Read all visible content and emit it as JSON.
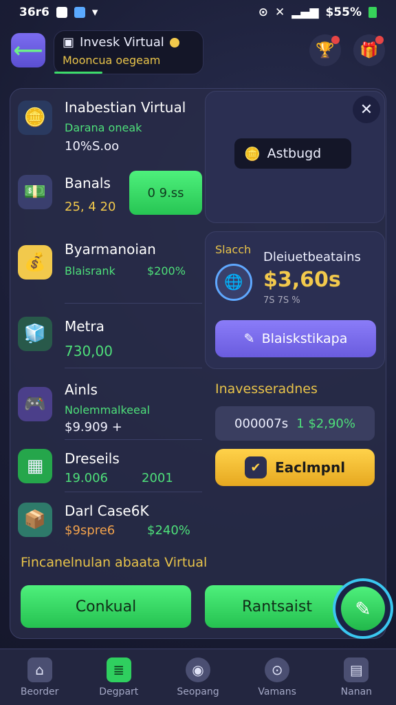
{
  "status_bar": {
    "time": "36r6",
    "right": "$55%"
  },
  "header": {
    "title": "Invesk Virtual",
    "subtitle": "Mooncua oegeam"
  },
  "list": [
    {
      "title": "Inabestian Virtual",
      "sub": "Darana oneak",
      "value": "10%S.oo",
      "icon": "coin-stack-icon",
      "color": "#f2c94c"
    },
    {
      "title": "Banals",
      "sub": "",
      "value": "25, 4 20",
      "icon": "money-box-icon",
      "color": "#cfd3ff",
      "button": "0 9.ss"
    },
    {
      "title": "Byarmanoian",
      "sub": "Blaisrank",
      "sub_value": "$200%",
      "icon": "cash-box-icon",
      "color": "#f2c94c"
    },
    {
      "title": "Metra",
      "sub": "",
      "value": "730,00",
      "icon": "cubes-icon",
      "color": "#4ee07a"
    },
    {
      "title": "Ainls",
      "sub": "Nolemmalkeeal",
      "value": "$9.909 +",
      "icon": "gamepad-icon",
      "color": "#8a7cf8"
    },
    {
      "title": "Dreseils",
      "sub": "",
      "value": "19.006",
      "value2": "2001",
      "icon": "green-box-icon",
      "color": "#4ee07a"
    },
    {
      "title": "Darl Case6K",
      "sub": "",
      "value": "$9spre6",
      "value2": "$240%",
      "icon": "crate-icon",
      "color": "#5fd3ff"
    }
  ],
  "card_top": {
    "chip": "Astbugd"
  },
  "card_balance": {
    "label": "Slacch",
    "title": "Dleiuetbeatains",
    "amount": "$3,60s",
    "small": "7S 7S %",
    "button": "Blaiskstikapa"
  },
  "invest": {
    "label": "Inavesseradnes",
    "field_left": "000007s",
    "field_right": "1 $2,90%",
    "button": "Eaclmpnl"
  },
  "footer_note": "Fincanelnulan abaata Virtual",
  "actions": {
    "left": "Conkual",
    "right": "Rantsaist"
  },
  "nav": [
    {
      "label": "Beorder",
      "icon": "home-icon"
    },
    {
      "label": "Degpart",
      "icon": "document-icon",
      "active": true
    },
    {
      "label": "Seopang",
      "icon": "palette-icon"
    },
    {
      "label": "Vamans",
      "icon": "lock-icon"
    },
    {
      "label": "Nanan",
      "icon": "briefcase-icon"
    }
  ]
}
